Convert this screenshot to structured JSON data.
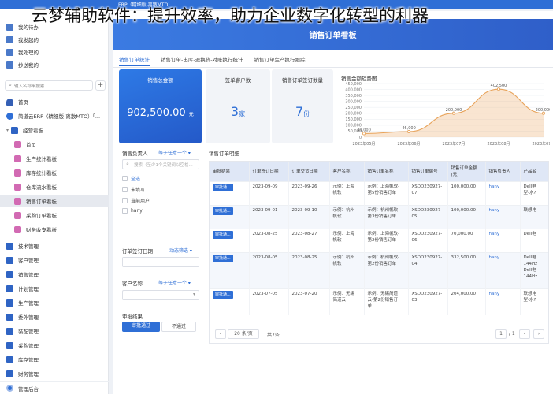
{
  "overlay_title": "云梦辅助软件：提升效率，助力企业数字化转型的利器",
  "app": {
    "brand": "ERP（精细版-离散MTO）"
  },
  "sidebar": {
    "items": [
      {
        "label": "我的待办"
      },
      {
        "label": "我发起的"
      },
      {
        "label": "我处理的"
      },
      {
        "label": "抄送我的"
      }
    ],
    "search_placeholder": "输入名称来搜索",
    "plus": "+",
    "nav": [
      {
        "label": "首页"
      },
      {
        "label": "简道云ERP（精细版-离散MTO）「..."
      },
      {
        "label": "经营看板"
      },
      {
        "label": "首页"
      },
      {
        "label": "生产统计看板"
      },
      {
        "label": "库存统计看板"
      },
      {
        "label": "仓库流水看板"
      },
      {
        "label": "销售订单看板"
      },
      {
        "label": "采购订单看板"
      },
      {
        "label": "财务收支看板"
      },
      {
        "label": "技术管理"
      },
      {
        "label": "客户管理"
      },
      {
        "label": "销售管理"
      },
      {
        "label": "计划管理"
      },
      {
        "label": "生产管理"
      },
      {
        "label": "委外管理"
      },
      {
        "label": "装配管理"
      },
      {
        "label": "采购管理"
      },
      {
        "label": "库存管理"
      },
      {
        "label": "财务管理"
      }
    ],
    "footer": "管理后台"
  },
  "main": {
    "banner_title": "销售订单看板",
    "tabs": [
      {
        "label": "销售订单统计"
      },
      {
        "label": "销售订单-出库-退换货-对账执行统计"
      },
      {
        "label": "销售订单生产执行跟踪"
      }
    ]
  },
  "kpis": [
    {
      "label": "销售总金额",
      "value": "902,500.00",
      "unit": "元"
    },
    {
      "label": "签单客户数",
      "value": "3",
      "unit": "家"
    },
    {
      "label": "销售订单签订数量",
      "value": "7",
      "unit": "份"
    }
  ],
  "chart_data": {
    "type": "area",
    "title": "销售金额趋势图",
    "categories": [
      "2023年05月",
      "2023年06月",
      "2023年07月",
      "2023年08月",
      "2023年09月"
    ],
    "values": [
      30000,
      46000,
      200000,
      402500,
      200000
    ],
    "data_labels": [
      "30,000",
      "46,000",
      "200,000",
      "402,500",
      "200,000"
    ],
    "y_ticks": [
      "0",
      "50,000",
      "100,000",
      "150,000",
      "200,000",
      "250,000",
      "300,000",
      "350,000",
      "400,000",
      "450,000"
    ],
    "ylim": [
      0,
      450000
    ],
    "color": "#e8a35a",
    "grid": true
  },
  "filters": {
    "salesperson": {
      "label": "销售负责人",
      "link": "等于任意一个 ▾",
      "placeholder": "搜索（至少1个关键词以空格...",
      "options": [
        {
          "label": "全选"
        },
        {
          "label": "未填写"
        },
        {
          "label": "当前用户"
        },
        {
          "label": "hany"
        }
      ]
    },
    "date": {
      "label": "订单签订日期",
      "link": "动态筛选 ▾"
    },
    "customer": {
      "label": "客户名称",
      "link": "等于任意一个 ▾"
    },
    "result": {
      "label": "审批结果"
    },
    "approve_btn": "审批通过",
    "reject_btn": "不通过"
  },
  "table": {
    "title": "销售订单明细",
    "headers": [
      "审批结果",
      "订单签订日期",
      "订单交货日期",
      "客户名称",
      "销售订单名称",
      "销售订单编号",
      "销售订单金额(元)",
      "销售负责人",
      "产品名"
    ],
    "rows": [
      [
        "审批通...",
        "2023-09-09",
        "2023-09-26",
        "示例：上海\n帆软",
        "示例：上海帆软-\n第5份销售订单",
        "XSDD230927-\n07",
        "100,000.00",
        "hany",
        "Dell电\n型-水?"
      ],
      [
        "审批通...",
        "2023-09-01",
        "2023-09-10",
        "示例：杭州\n帆软",
        "示例：杭州帆软-\n第3份销售订单",
        "XSDD230927-\n05",
        "100,000.00",
        "hany",
        "联想电"
      ],
      [
        "审批通...",
        "2023-08-25",
        "2023-08-27",
        "示例：上海\n帆软",
        "示例：上海帆软-\n第2份销售订单",
        "XSDD230927-\n06",
        "70,000.00",
        "hany",
        "Dell电"
      ],
      [
        "审批通...",
        "2023-08-05",
        "2023-08-25",
        "示例：杭州\n帆软",
        "示例：杭州帆软-\n第2份销售订单",
        "XSDD230927-\n04",
        "332,500.00",
        "hany",
        "Dell电\n144Hz\nDell电\n144Hz"
      ],
      [
        "审批通...",
        "2023-07-05",
        "2023-07-20",
        "示例：无锡\n简道云",
        "示例：无锡简道\n云-第2份销售订\n单",
        "XSDD230927-\n03",
        "204,000.00",
        "hany",
        "联想电\n型-水?"
      ]
    ],
    "pager": {
      "page_size": "20 条/页",
      "total": "共7条",
      "current": "1",
      "pages": "/ 1"
    }
  }
}
